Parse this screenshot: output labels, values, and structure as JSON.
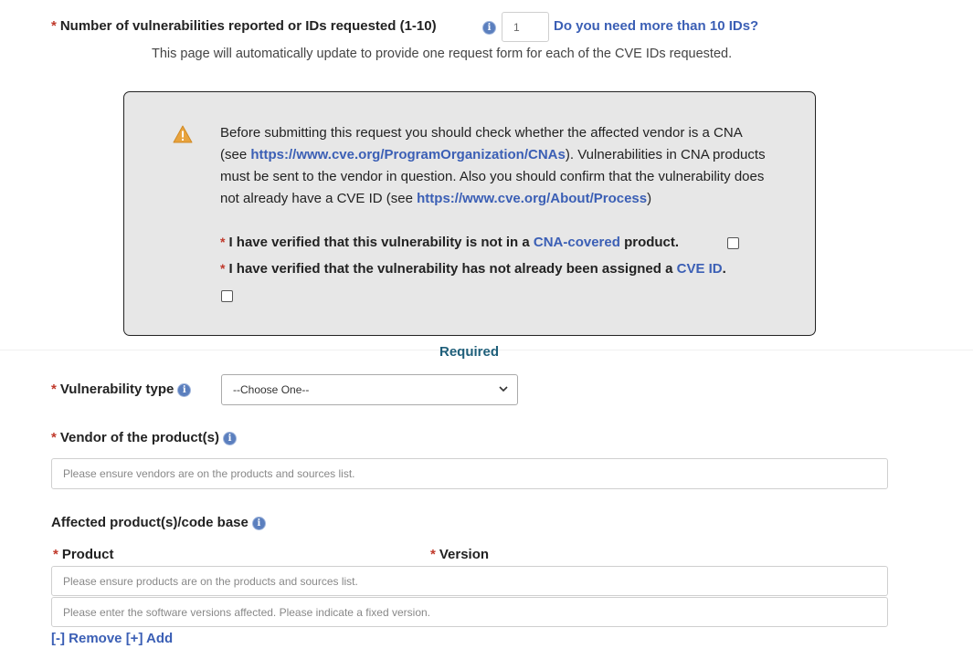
{
  "count_field": {
    "label": "Number of vulnerabilities reported or IDs requested (1-10)",
    "value": "1",
    "more_link": "Do you need more than 10 IDs?",
    "hint": "This page will automatically update to provide one request form for each of the CVE IDs requested."
  },
  "notice": {
    "text_before": "Before submitting this request you should check whether the affected vendor is a CNA (see ",
    "cna_url": "https://www.cve.org/ProgramOrganization/CNAs",
    "text_middle": "). Vulnerabilities in CNA products must be sent to the vendor in question. Also you should confirm that the vulnerability does not already have a CVE ID (see ",
    "process_url": "https://www.cve.org/About/Process",
    "text_after": ")",
    "check1_prefix": "I have verified that this vulnerability is not in a ",
    "check1_link": "CNA-covered",
    "check1_suffix": " product.",
    "check2_prefix": "I have verified that the vulnerability has not already been assigned a ",
    "check2_link": "CVE ID",
    "check2_suffix": "."
  },
  "required_label": "Required",
  "vuln_type": {
    "label": "Vulnerability type",
    "selected": "--Choose One--"
  },
  "vendor": {
    "label": "Vendor of the product(s)",
    "placeholder": "Please ensure vendors are on the products and sources list."
  },
  "affected": {
    "label": "Affected product(s)/code base",
    "product_label": "Product",
    "version_label": "Version",
    "product_placeholder": "Please ensure products are on the products and sources list.",
    "version_placeholder": "Please enter the software versions affected. Please indicate a fixed version.",
    "remove_link": "[-] Remove",
    "add_link": "[+] Add"
  },
  "colors": {
    "required_star": "#c0392b",
    "link": "#3b5fb5",
    "required_heading": "#1f5f7a",
    "notice_bg": "#e7e7e7",
    "warning": "#e8a33d",
    "info_icon": "#5b7fbe"
  }
}
